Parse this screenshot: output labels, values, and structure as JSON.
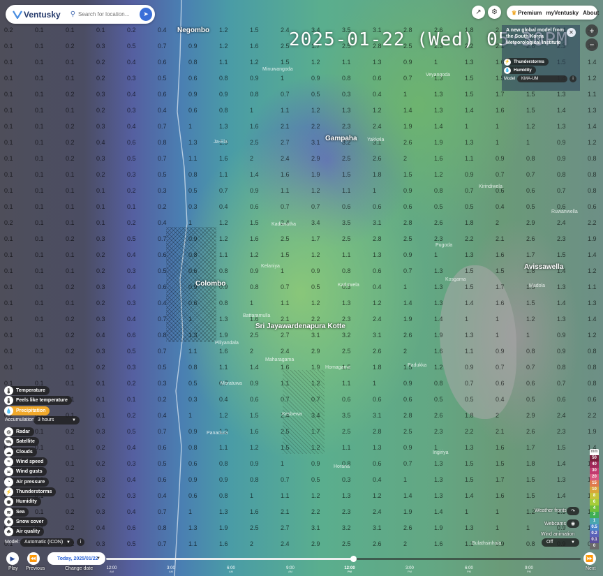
{
  "colors": {
    "accent": "#f0a82a",
    "brand": "#253a6b",
    "primary_blue": "#3a6fd8"
  },
  "header": {
    "logo_text": "Ventusky",
    "search_placeholder": "Search for location...",
    "premium_label": "Premium",
    "my_ventusky_label": "myVentusky",
    "about_label": "About"
  },
  "datetime": "2025-01-22 (Wed) 05:30PM",
  "announcement": {
    "text": "A new global model from the South Korea Meteorological Institute",
    "chips": [
      "Thunderstorms",
      "Humidity"
    ],
    "model_label": "Model",
    "model_value": "KMA-UM"
  },
  "layers": [
    {
      "label": "Temperature",
      "icon": "thermometer-icon",
      "active": false
    },
    {
      "label": "Feels like temperature",
      "icon": "thermometer-icon",
      "active": false
    },
    {
      "label": "Precipitation",
      "icon": "raindrop-icon",
      "active": true
    },
    {
      "label": "Radar",
      "icon": "radar-icon",
      "active": false
    },
    {
      "label": "Satellite",
      "icon": "satellite-icon",
      "active": false
    },
    {
      "label": "Clouds",
      "icon": "cloud-icon",
      "active": false
    },
    {
      "label": "Wind speed",
      "icon": "wind-icon",
      "active": false
    },
    {
      "label": "Wind gusts",
      "icon": "wind-gusts-icon",
      "active": false
    },
    {
      "label": "Air pressure",
      "icon": "pressure-icon",
      "active": false
    },
    {
      "label": "Thunderstorms",
      "icon": "lightning-icon",
      "active": false
    },
    {
      "label": "Humidity",
      "icon": "humidity-icon",
      "active": false
    },
    {
      "label": "Sea",
      "icon": "waves-icon",
      "active": false
    },
    {
      "label": "Snow cover",
      "icon": "snowflake-icon",
      "active": false
    },
    {
      "label": "Air quality",
      "icon": "air-quality-icon",
      "active": false
    }
  ],
  "controls": {
    "accumulation_label": "Accumulation:",
    "accumulation_value": "3 hours",
    "model_label": "Model:",
    "model_value": "Automatic (ICON)"
  },
  "legend": {
    "unit": "mm",
    "values": [
      "50",
      "40",
      "30",
      "20",
      "15",
      "10",
      "8",
      "6",
      "4",
      "2",
      "1",
      "0.5",
      "0.2",
      "0.1",
      "0"
    ],
    "colors": [
      "#7a1f3d",
      "#a0285a",
      "#c23a6f",
      "#d8567f",
      "#e07a4d",
      "#d9a63a",
      "#c8c43a",
      "#a6cd3a",
      "#6fbf3a",
      "#3fae55",
      "#4aa6b0",
      "#4a84c9",
      "#5b62b8",
      "#5a4f9a",
      "#6a6a6a"
    ]
  },
  "side": {
    "weather_fronts_label": "Weather fronts",
    "webcams_label": "Webcams",
    "wind_animation_label": "Wind animation",
    "wind_animation_value": "Off"
  },
  "timeline": {
    "play_label": "Play",
    "previous_label": "Previous",
    "change_date_label": "Change date",
    "next_label": "Next",
    "date_value": "Today, 2025/01/22",
    "progress": 0.52,
    "ticks": [
      {
        "time": "12:00",
        "period": "AM"
      },
      {
        "time": "3:00",
        "period": "AM"
      },
      {
        "time": "6:00",
        "period": "AM"
      },
      {
        "time": "9:00",
        "period": "AM"
      },
      {
        "time": "12:00",
        "period": "PM"
      },
      {
        "time": "3:00",
        "period": "PM"
      },
      {
        "time": "6:00",
        "period": "PM"
      },
      {
        "time": "9:00",
        "period": "PM"
      }
    ],
    "current_tick": 4
  },
  "cities": [
    {
      "name": "Negombo",
      "big": true
    },
    {
      "name": "Gampaha",
      "big": true
    },
    {
      "name": "Colombo",
      "big": true
    },
    {
      "name": "Sri Jayawardenapura Kotte",
      "big": true
    },
    {
      "name": "Avissawella",
      "big": true
    },
    {
      "name": "Kosgama",
      "big": false
    },
    {
      "name": "Kadawatha",
      "big": false
    },
    {
      "name": "Ja-Ela",
      "big": false
    },
    {
      "name": "Minuwangoda",
      "big": false
    },
    {
      "name": "Kirindiwela",
      "big": false
    },
    {
      "name": "Kelaniya",
      "big": false
    },
    {
      "name": "Maharagama",
      "big": false
    },
    {
      "name": "Homagama",
      "big": false
    },
    {
      "name": "Moratuwa",
      "big": false
    },
    {
      "name": "Panadura",
      "big": false
    },
    {
      "name": "Horana",
      "big": false
    },
    {
      "name": "Padukka",
      "big": false
    },
    {
      "name": "Ingiriya",
      "big": false
    },
    {
      "name": "Bulathsinhala",
      "big": false
    },
    {
      "name": "Ruwanwella",
      "big": false
    },
    {
      "name": "Pugoda",
      "big": false
    },
    {
      "name": "Madola",
      "big": false
    },
    {
      "name": "Yakkala",
      "big": false
    },
    {
      "name": "Veyangoda",
      "big": false
    },
    {
      "name": "Battaramulla",
      "big": false
    },
    {
      "name": "Piliyandala",
      "big": false
    },
    {
      "name": "Kaduwela",
      "big": false
    },
    {
      "name": "Kesbewa",
      "big": false
    }
  ],
  "precip_values": [
    "0.2",
    "0.1",
    "0.1",
    "0.1",
    "0.2",
    "0.4",
    "1",
    "1.2",
    "1.5",
    "2.4",
    "3.4",
    "3.5",
    "3.1",
    "2.8",
    "2.6",
    "1.8",
    "2",
    "2.9",
    "2.4",
    "2.2",
    "0.1",
    "0.1",
    "0.2",
    "0.3",
    "0.5",
    "0.7",
    "0.9",
    "1.2",
    "1.6",
    "2.5",
    "1.7",
    "2.5",
    "2.8",
    "2.5",
    "2.3",
    "2.2",
    "2.1",
    "2.6",
    "2.3",
    "1.9",
    "0.1",
    "0.1",
    "0.1",
    "0.2",
    "0.4",
    "0.6",
    "0.8",
    "1.1",
    "1.2",
    "1.5",
    "1.2",
    "1.1",
    "1.3",
    "0.9",
    "1",
    "1.3",
    "1.6",
    "1.7",
    "1.5",
    "1.4",
    "0.1",
    "0.1",
    "0.1",
    "0.2",
    "0.3",
    "0.5",
    "0.6",
    "0.8",
    "0.9",
    "1",
    "0.9",
    "0.8",
    "0.6",
    "0.7",
    "1.3",
    "1.5",
    "1.5",
    "1.8",
    "1.4",
    "1.2",
    "0.1",
    "0.1",
    "0.2",
    "0.3",
    "0.4",
    "0.6",
    "0.9",
    "0.9",
    "0.8",
    "0.7",
    "0.5",
    "0.3",
    "0.4",
    "1",
    "1.3",
    "1.5",
    "1.7",
    "1.5",
    "1.3",
    "1.1",
    "0.1",
    "0.1",
    "0.1",
    "0.2",
    "0.3",
    "0.4",
    "0.6",
    "0.8",
    "1",
    "1.1",
    "1.2",
    "1.3",
    "1.2",
    "1.4",
    "1.3",
    "1.4",
    "1.6",
    "1.5",
    "1.4",
    "1.3",
    "0.1",
    "0.1",
    "0.2",
    "0.3",
    "0.4",
    "0.7",
    "1",
    "1.3",
    "1.6",
    "2.1",
    "2.2",
    "2.3",
    "2.4",
    "1.9",
    "1.4",
    "1",
    "1",
    "1.2",
    "1.3",
    "1.4",
    "0.1",
    "0.1",
    "0.2",
    "0.4",
    "0.6",
    "0.8",
    "1.3",
    "1.9",
    "2.5",
    "2.7",
    "3.1",
    "3.2",
    "3.1",
    "2.6",
    "1.9",
    "1.3",
    "1",
    "1",
    "0.9",
    "1.2",
    "0.1",
    "0.1",
    "0.2",
    "0.3",
    "0.5",
    "0.7",
    "1.1",
    "1.6",
    "2",
    "2.4",
    "2.9",
    "2.5",
    "2.6",
    "2",
    "1.6",
    "1.1",
    "0.9",
    "0.8",
    "0.9",
    "0.8",
    "0.1",
    "0.1",
    "0.1",
    "0.2",
    "0.3",
    "0.5",
    "0.8",
    "1.1",
    "1.4",
    "1.6",
    "1.9",
    "1.5",
    "1.8",
    "1.5",
    "1.2",
    "0.9",
    "0.7",
    "0.7",
    "0.8",
    "0.8",
    "0.1",
    "0.1",
    "0.1",
    "0.1",
    "0.2",
    "0.3",
    "0.5",
    "0.7",
    "0.9",
    "1.1",
    "1.2",
    "1.1",
    "1",
    "0.9",
    "0.8",
    "0.7",
    "0.6",
    "0.6",
    "0.7",
    "0.8",
    "0.1",
    "0.1",
    "0.1",
    "0.1",
    "0.1",
    "0.2",
    "0.3",
    "0.4",
    "0.6",
    "0.7",
    "0.7",
    "0.6",
    "0.6",
    "0.6",
    "0.5",
    "0.5",
    "0.4",
    "0.5",
    "0.6",
    "0.6"
  ]
}
